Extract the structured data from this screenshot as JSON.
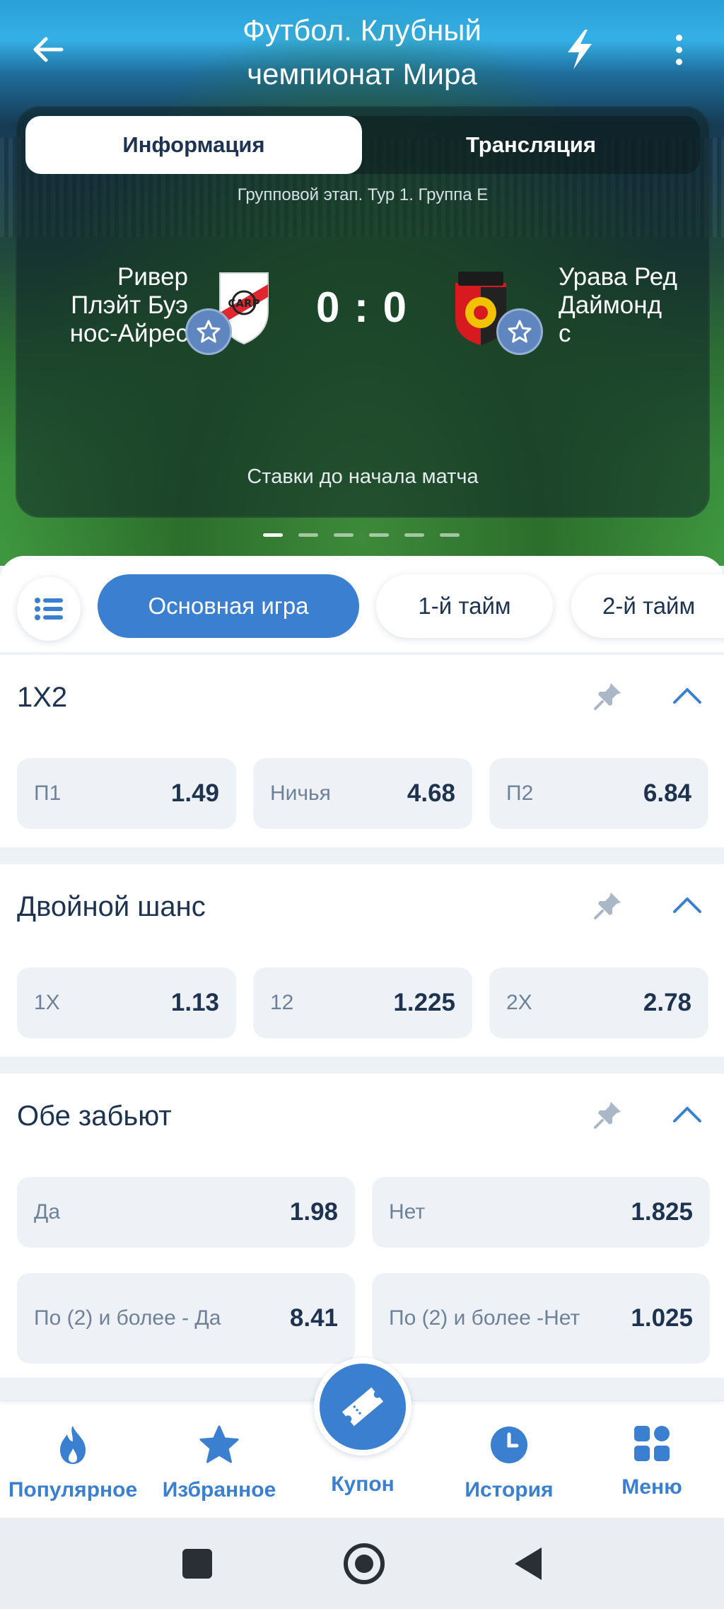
{
  "header": {
    "title_line1": "Футбол. Клубный",
    "title_line2": "чемпионат Мира"
  },
  "match": {
    "tabs": {
      "info": "Информация",
      "broadcast": "Трансляция"
    },
    "stage": "Групповой этап. Тур 1. Группа E",
    "team1_lines": [
      "Ривер",
      "Плэйт Буэ",
      "нос-Айрес"
    ],
    "team2_lines": [
      "Урава Ред",
      "Даймонд",
      "с"
    ],
    "score": "0 : 0",
    "status": "Ставки до начала матча",
    "pager": {
      "count": 6,
      "active": 0
    }
  },
  "filters": {
    "main": "Основная игра",
    "half1": "1-й тайм",
    "half2": "2-й тайм"
  },
  "markets": [
    {
      "title": "1X2",
      "odds": [
        {
          "label": "П1",
          "value": "1.49"
        },
        {
          "label": "Ничья",
          "value": "4.68"
        },
        {
          "label": "П2",
          "value": "6.84"
        }
      ]
    },
    {
      "title": "Двойной шанс",
      "odds": [
        {
          "label": "1X",
          "value": "1.13"
        },
        {
          "label": "12",
          "value": "1.225"
        },
        {
          "label": "2X",
          "value": "2.78"
        }
      ]
    },
    {
      "title": "Обе забьют",
      "odds": [
        {
          "label": "Да",
          "value": "1.98"
        },
        {
          "label": "Нет",
          "value": "1.825"
        },
        {
          "label": "По (2) и более - Да",
          "value": "8.41"
        },
        {
          "label_line1": "По (2) и более -",
          "label_line2": "Нет",
          "value": "1.025"
        }
      ]
    }
  ],
  "bottom_nav": {
    "popular": "Популярное",
    "favorites": "Избранное",
    "coupon": "Купон",
    "history": "История",
    "menu": "Меню"
  },
  "colors": {
    "accent": "#3b7fd0",
    "text": "#1d3350",
    "muted": "#6f8199",
    "odd_bg": "#eef2f6"
  },
  "icons": [
    "back-arrow-icon",
    "lightning-icon",
    "more-vertical-icon",
    "star-icon",
    "list-icon",
    "pin-icon",
    "chevron-up-icon",
    "flame-icon",
    "ticket-icon",
    "clock-icon",
    "grid-icon"
  ]
}
